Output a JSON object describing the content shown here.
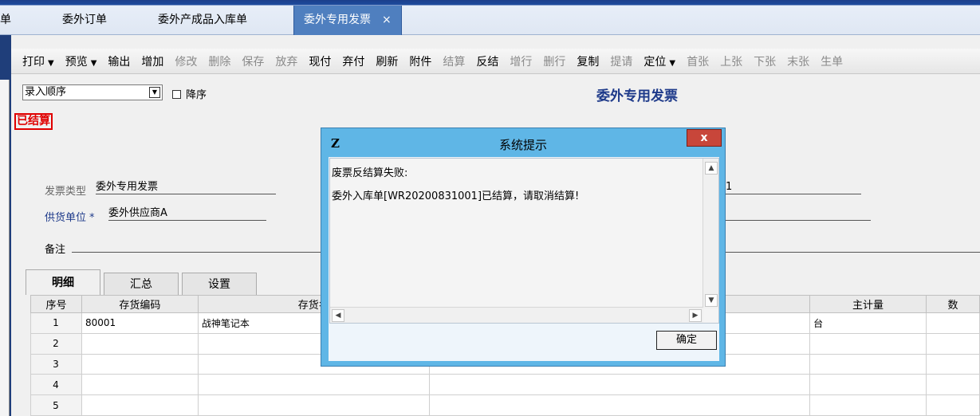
{
  "tabs": [
    {
      "label": "单"
    },
    {
      "label": "委外订单"
    },
    {
      "label": "委外产成品入库单"
    },
    {
      "label": "委外专用发票",
      "close": "×"
    }
  ],
  "toolbar": [
    {
      "label": "打印",
      "dropdown": true
    },
    {
      "label": "预览",
      "dropdown": true
    },
    {
      "label": "输出"
    },
    {
      "label": "增加"
    },
    {
      "label": "修改",
      "disabled": true
    },
    {
      "label": "删除",
      "disabled": true
    },
    {
      "label": "保存",
      "disabled": true
    },
    {
      "label": "放弃",
      "disabled": true
    },
    {
      "label": "现付"
    },
    {
      "label": "弃付"
    },
    {
      "label": "刷新"
    },
    {
      "label": "附件"
    },
    {
      "label": "结算",
      "disabled": true
    },
    {
      "label": "反结"
    },
    {
      "label": "增行",
      "disabled": true
    },
    {
      "label": "删行",
      "disabled": true
    },
    {
      "label": "复制"
    },
    {
      "label": "提请",
      "disabled": true
    },
    {
      "label": "定位",
      "dropdown": true
    },
    {
      "label": "首张",
      "disabled": true
    },
    {
      "label": "上张",
      "disabled": true
    },
    {
      "label": "下张",
      "disabled": true
    },
    {
      "label": "末张",
      "disabled": true
    },
    {
      "label": "生单",
      "disabled": true
    }
  ],
  "form": {
    "sort_value": "录入顺序",
    "desc_label": "降序",
    "title": "委外专用发票",
    "status": "已结算",
    "invoice_type_label": "发票类型",
    "invoice_type_value": "委外专用发票",
    "supplier_label": "供货单位",
    "supplier_required": "*",
    "supplier_value": "委外供应商A",
    "remark_label": "备注",
    "partial_right_value": "1"
  },
  "detail_tabs": [
    "明细",
    "汇总",
    "设置"
  ],
  "grid": {
    "headers": [
      "序号",
      "存货编码",
      "存货名",
      "",
      "主计量",
      "数"
    ],
    "rows": [
      [
        "1",
        "80001",
        "战神笔记本",
        "",
        "台",
        ""
      ],
      [
        "2",
        "",
        "",
        "",
        "",
        ""
      ],
      [
        "3",
        "",
        "",
        "",
        "",
        ""
      ],
      [
        "4",
        "",
        "",
        "",
        "",
        ""
      ],
      [
        "5",
        "",
        "",
        "",
        "",
        ""
      ]
    ]
  },
  "dialog": {
    "logo": "Z",
    "title": "系统提示",
    "close": "x",
    "line1": "废票反结算失败:",
    "line2": "委外入库单[WR20200831001]已结算，请取消结算!",
    "ok": "确定"
  },
  "colors": {
    "accent": "#1e3a8a",
    "status_red": "#e00000",
    "dialog_blue": "#5fb6e6",
    "close_red": "#c8463a",
    "tab_active": "#4f7fbf"
  }
}
